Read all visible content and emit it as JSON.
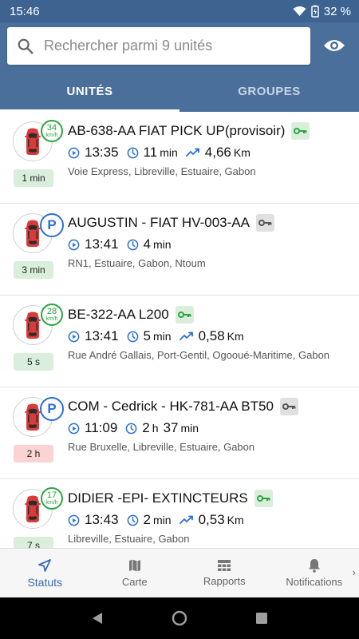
{
  "status_bar": {
    "time": "15:46",
    "battery": "32 %"
  },
  "search": {
    "placeholder": "Rechercher parmi 9 unités"
  },
  "tabs": [
    {
      "label": "UNITÉS",
      "active": true
    },
    {
      "label": "GROUPES",
      "active": false
    }
  ],
  "units": [
    {
      "name": "AB-638-AA FIAT PICK UP(provisoir)",
      "status": "moving",
      "speed": "34",
      "speed_unit": "km/h",
      "time_badge": "1 min",
      "time_badge_color": "green",
      "ignition": "on",
      "clock": "13:35",
      "duration_value": "11",
      "duration_unit": "min",
      "duration_value2": "",
      "duration_unit2": "",
      "distance_value": "4,66",
      "distance_unit": "Km",
      "address": "Voie Express, Libreville, Estuaire, Gabon"
    },
    {
      "name": "AUGUSTIN - FIAT HV-003-AA",
      "status": "parked",
      "badge_letter": "P",
      "time_badge": "3 min",
      "time_badge_color": "green",
      "ignition": "off",
      "clock": "13:41",
      "duration_value": "4",
      "duration_unit": "min",
      "duration_value2": "",
      "duration_unit2": "",
      "distance_value": "",
      "distance_unit": "",
      "address": "RN1, Estuaire, Gabon, Ntoum"
    },
    {
      "name": "BE-322-AA L200",
      "status": "moving",
      "speed": "28",
      "speed_unit": "km/h",
      "time_badge": "5 s",
      "time_badge_color": "green",
      "ignition": "on",
      "clock": "13:41",
      "duration_value": "5",
      "duration_unit": "min",
      "duration_value2": "",
      "duration_unit2": "",
      "distance_value": "0,58",
      "distance_unit": "Km",
      "address": "Rue André Gallais, Port-Gentil, Ogooué-Maritime, Gabon"
    },
    {
      "name": "COM - Cedrick - HK-781-AA BT50",
      "status": "parked",
      "badge_letter": "P",
      "time_badge": "2 h",
      "time_badge_color": "red",
      "ignition": "off",
      "clock": "11:09",
      "duration_value": "2",
      "duration_unit": "h",
      "duration_value2": "37",
      "duration_unit2": "min",
      "distance_value": "",
      "distance_unit": "",
      "address": "Rue Bruxelle, Libreville, Estuaire, Gabon"
    },
    {
      "name": "DIDIER -EPI- EXTINCTEURS",
      "status": "moving",
      "speed": "17",
      "speed_unit": "km/h",
      "time_badge": "7 s",
      "time_badge_color": "green",
      "ignition": "on",
      "clock": "13:43",
      "duration_value": "2",
      "duration_unit": "min",
      "duration_value2": "",
      "duration_unit2": "",
      "distance_value": "0,53",
      "distance_unit": "Km",
      "address": "Libreville, Estuaire, Gabon"
    }
  ],
  "bottom_nav": [
    {
      "label": "Statuts",
      "icon": "navigation-arrow-icon",
      "active": true
    },
    {
      "label": "Carte",
      "icon": "map-icon",
      "active": false
    },
    {
      "label": "Rapports",
      "icon": "table-icon",
      "active": false
    },
    {
      "label": "Notifications",
      "icon": "bell-icon",
      "active": false
    }
  ],
  "colors": {
    "header": "#4a6f9a",
    "status_bar": "#3d6391",
    "accent_blue": "#2a6fd6",
    "green": "#2aa640",
    "car_red": "#d93a3a"
  }
}
